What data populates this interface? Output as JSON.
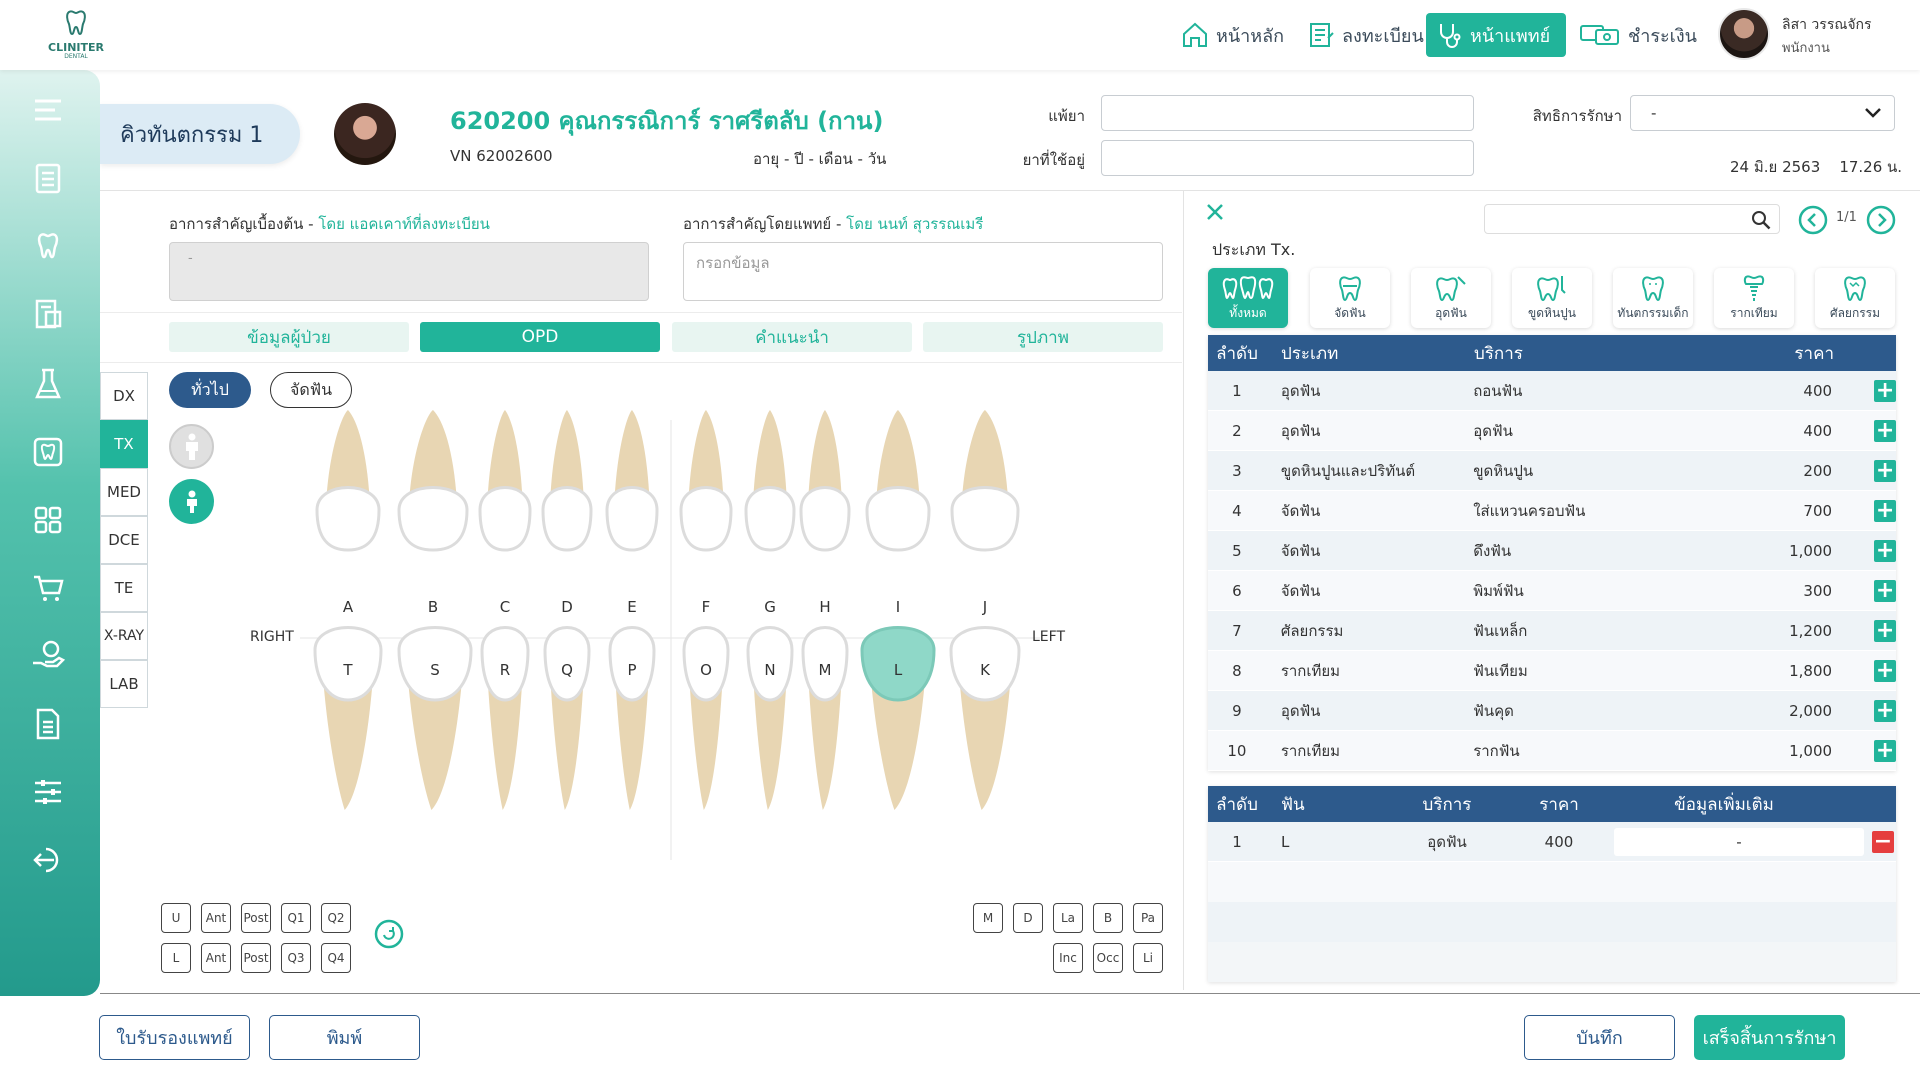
{
  "header": {
    "logo": {
      "name": "CLINITER",
      "sub": "DENTAL"
    },
    "nav": [
      {
        "label": "หน้าหลัก",
        "icon": "home-icon"
      },
      {
        "label": "ลงทะเบียน",
        "icon": "register-icon"
      },
      {
        "label": "หน้าแพทย์",
        "icon": "stethoscope-icon",
        "active": true
      },
      {
        "label": "ชำระเงิน",
        "icon": "payment-icon"
      }
    ],
    "user": {
      "name": "ลิสา วรรณจักร",
      "role": "พนักงาน"
    }
  },
  "sidebar": {
    "icons": [
      "menu-icon",
      "clipboard-icon",
      "tooth-icon",
      "register-card-icon",
      "flask-icon",
      "tooth-card-icon",
      "grid-icon",
      "cart-icon",
      "money-hand-icon",
      "document-icon",
      "sliders-icon",
      "logout-icon"
    ]
  },
  "patient": {
    "queue": "คิวทันตกรรม 1",
    "name": "620200 คุณกรรณิการ์ ราศรีตลับ (กาน)",
    "vn": "VN 62002600",
    "age": "อายุ  - ปี  - เดือน  - วัน",
    "allergy_label": "แพ้ยา",
    "allergy_value": "",
    "current_meds_label": "ยาที่ใช้อยู่",
    "current_meds_value": "",
    "coverage_label": "สิทธิการรักษา",
    "coverage_value": "-",
    "date": "24 มิ.ย 2563",
    "time": "17.26 น."
  },
  "symptoms": {
    "initial_label": "อาการสำคัญเบื้องต้น - ",
    "initial_by": "โดย แอคเคาท์ที่ลงทะเบียน",
    "initial_value": "-",
    "doctor_label": "อาการสำคัญโดยแพทย์ - ",
    "doctor_by": "โดย นนท์ สุวรรณเมรี",
    "doctor_placeholder": "กรอกข้อมูล"
  },
  "panel_tabs": [
    {
      "label": "ข้อมูลผู้ป่วย",
      "active": false
    },
    {
      "label": "OPD",
      "active": true
    },
    {
      "label": "คำแนะนำ",
      "active": false
    },
    {
      "label": "รูปภาพ",
      "active": false
    }
  ],
  "side_tabs": [
    {
      "label": "DX",
      "active": false
    },
    {
      "label": "TX",
      "active": true
    },
    {
      "label": "MED",
      "active": false
    },
    {
      "label": "DCE",
      "active": false
    },
    {
      "label": "TE",
      "active": false
    },
    {
      "label": "X-RAY",
      "active": false
    },
    {
      "label": "LAB",
      "active": false
    }
  ],
  "chart_mode": {
    "general": "ทั่วไป",
    "ortho": "จัดฟัน",
    "selected": "general"
  },
  "teeth": {
    "upper": [
      "A",
      "B",
      "C",
      "D",
      "E",
      "F",
      "G",
      "H",
      "I",
      "J"
    ],
    "lower": [
      "T",
      "S",
      "R",
      "Q",
      "P",
      "O",
      "N",
      "M",
      "L",
      "K"
    ],
    "right_label": "RIGHT",
    "left_label": "LEFT",
    "highlighted": [
      "L"
    ]
  },
  "quadrant_buttons": {
    "row1": [
      "U",
      "Ant",
      "Post",
      "Q1",
      "Q2"
    ],
    "row2": [
      "L",
      "Ant",
      "Post",
      "Q3",
      "Q4"
    ]
  },
  "surface_buttons": {
    "row1": [
      "M",
      "D",
      "La",
      "B",
      "Pa"
    ],
    "row2": [
      "Inc",
      "Occ",
      "Li"
    ]
  },
  "treatment": {
    "pager": "1/1",
    "type_label": "ประเภท Tx.",
    "categories": [
      {
        "label": "ทั้งหมด",
        "icon": "all-teeth-icon",
        "active": true
      },
      {
        "label": "จัดฟัน",
        "icon": "ortho-icon"
      },
      {
        "label": "อุดฟัน",
        "icon": "filling-icon"
      },
      {
        "label": "ขูดหินปูน",
        "icon": "scaling-icon"
      },
      {
        "label": "ทันตกรรมเด็ก",
        "icon": "kid-tooth-icon"
      },
      {
        "label": "รากเทียม",
        "icon": "implant-icon"
      },
      {
        "label": "ศัลยกรรม",
        "icon": "surgery-icon"
      }
    ],
    "columns": [
      "ลำดับ",
      "ประเภท",
      "บริการ",
      "ราคา"
    ],
    "rows": [
      {
        "no": "1",
        "type": "อุดฟัน",
        "service": "ถอนฟัน",
        "price": "400"
      },
      {
        "no": "2",
        "type": "อุดฟัน",
        "service": "อุดฟัน",
        "price": "400"
      },
      {
        "no": "3",
        "type": "ขูดหินปูนและปริทันต์",
        "service": "ขูดหินปูน",
        "price": "200"
      },
      {
        "no": "4",
        "type": "จัดฟัน",
        "service": "ใส่แหวนครอบฟัน",
        "price": "700"
      },
      {
        "no": "5",
        "type": "จัดฟัน",
        "service": "ดึงฟัน",
        "price": "1,000"
      },
      {
        "no": "6",
        "type": "จัดฟัน",
        "service": "พิมพ์ฟัน",
        "price": "300"
      },
      {
        "no": "7",
        "type": "ศัลยกรรม",
        "service": "ฟันเหล็ก",
        "price": "1,200"
      },
      {
        "no": "8",
        "type": "รากเทียม",
        "service": "ฟันเทียม",
        "price": "1,800"
      },
      {
        "no": "9",
        "type": "อุดฟัน",
        "service": "ฟันคุด",
        "price": "2,000"
      },
      {
        "no": "10",
        "type": "รากเทียม",
        "service": "รากฟัน",
        "price": "1,000"
      }
    ],
    "selected_columns": [
      "ลำดับ",
      "ฟัน",
      "บริการ",
      "ราคา",
      "ข้อมูลเพิ่มเติม"
    ],
    "selected_rows": [
      {
        "no": "1",
        "tooth": "L",
        "service": "อุดฟัน",
        "price": "400",
        "note": "-"
      }
    ]
  },
  "footer": {
    "certificate": "ใบรับรองแพทย์",
    "print": "พิมพ์",
    "save": "บันทึก",
    "finish": "เสร็จสิ้นการรักษา"
  },
  "colors": {
    "primary": "#21b49a",
    "navy": "#2d5a8c",
    "tooth": "#e8d6b3",
    "crown": "#ffffff",
    "highlight": "#8fd8c8"
  }
}
